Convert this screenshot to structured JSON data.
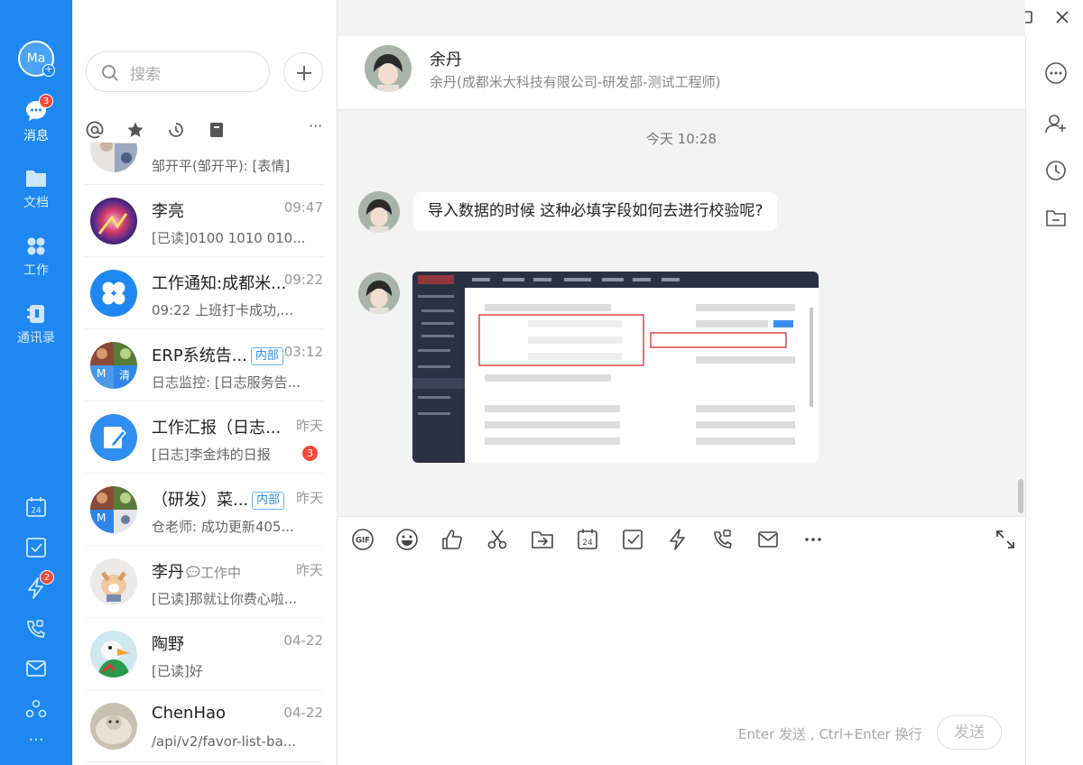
{
  "rail": {
    "avatar_text": "Ma",
    "items": [
      {
        "label": "消息",
        "icon": "chat-bubble-icon",
        "badge": "3"
      },
      {
        "label": "文档",
        "icon": "folder-icon"
      },
      {
        "label": "工作",
        "icon": "grid-icon"
      },
      {
        "label": "通讯录",
        "icon": "contacts-icon"
      }
    ],
    "bottom_badge": "2",
    "more": "···",
    "calendar_day": "24"
  },
  "search": {
    "placeholder": "搜索"
  },
  "conversations": [
    {
      "name": "",
      "preview": "邹开平(邹开平): [表情]",
      "time": ""
    },
    {
      "name": "李亮",
      "preview": "[已读]0100 1010 010...",
      "time": "09:47"
    },
    {
      "name": "工作通知:成都米...",
      "preview": "09:22 上班打卡成功,...",
      "time": "09:22"
    },
    {
      "name": "ERP系统告...",
      "tag": "内部",
      "preview": "日志监控: [日志服务告...",
      "time": "03:12",
      "avatar_letters": [
        "M",
        "清"
      ]
    },
    {
      "name": "工作汇报（日志...",
      "preview": "[日志]李金炜的日报",
      "time": "昨天",
      "unread": "3"
    },
    {
      "name": "（研发）菜...",
      "tag": "内部",
      "preview": "仓老师: 成功更新405...",
      "time": "昨天",
      "avatar_letters": [
        "M"
      ]
    },
    {
      "name": "李丹",
      "status": "工作中",
      "preview": "[已读]那就让你费心啦...",
      "time": "昨天"
    },
    {
      "name": "陶野",
      "preview": "[已读]好",
      "time": "04-22"
    },
    {
      "name": "ChenHao",
      "preview": "/api/v2/favor-list-ba...",
      "time": "04-22"
    }
  ],
  "chat": {
    "name": "余丹",
    "subtitle": "余丹(成都米大科技有限公司-研发部-测试工程师)",
    "timestamp": "今天 10:28",
    "message": "导入数据的时候  这种必填字段如何去进行校验呢?",
    "composer_hint": "Enter 发送 , Ctrl+Enter 换行",
    "send_label": "发送",
    "gif_label": "GIF",
    "calendar_day": "24"
  },
  "colors": {
    "brand": "#1e88f0",
    "badge": "#f04b3e"
  }
}
